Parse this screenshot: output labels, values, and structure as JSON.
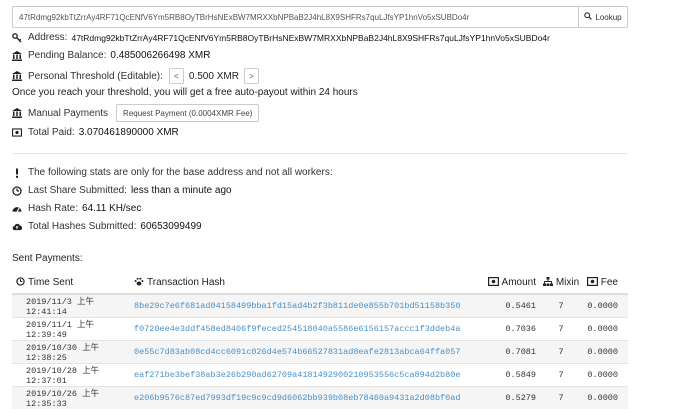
{
  "lookup": {
    "address_value": "47tRdmg92kbTtZrrAy4RF71QcENfV6Ym5RB8OyTBrHsNExBW7MRXXbNPBaB2J4hL8X9SHFRs7quLJfsYP1hnVo5xSUBDo4r",
    "button_label": "Lookup"
  },
  "stats": {
    "address_label": "Address:",
    "address_value": "47tRdmg92kbTtZrrAy4RF71QcENfV6Ym5RB8OyTBrHsNExBW7MRXXbNPBaB2J4hL8X9SHFRs7quLJfsYP1hnVo5xSUBDo4r",
    "pending_label": "Pending Balance:",
    "pending_value": "0.485006266498 XMR",
    "threshold_label": "Personal Threshold (Editable):",
    "threshold_dec": "<",
    "threshold_value": "0.500 XMR",
    "threshold_inc": ">",
    "threshold_note": "Once you reach your threshold, you will get a free auto-payout within 24 hours",
    "manual_label": "Manual Payments",
    "manual_button": "Request Payment (0.0004XMR Fee)",
    "total_paid_label": "Total Paid:",
    "total_paid_value": "3.070461890000 XMR"
  },
  "base_stats": {
    "notice": "The following stats are only for the base address and not all workers:",
    "last_share_label": "Last Share Submitted:",
    "last_share_value": "less than a minute ago",
    "hash_rate_label": "Hash Rate:",
    "hash_rate_value": "64.11 KH/sec",
    "total_hashes_label": "Total Hashes Submitted:",
    "total_hashes_value": "60653099499"
  },
  "payments": {
    "section_title": "Sent Payments:",
    "headers": [
      "Time Sent",
      "Transaction Hash",
      "Amount",
      "Mixin",
      "Fee"
    ],
    "rows": [
      [
        "2019/11/3 上午12:41:14",
        "8be29c7e6f681ad04158499bba1fd15ad4b2f3b811de0e855b701bd51158b350",
        "0.5461",
        "7",
        "0.0000"
      ],
      [
        "2019/11/1 上午12:39:49",
        "f0720ee4e3ddf458ed8406f9feced254518040a5586e6156157accc1f3ddeb4a",
        "0.7036",
        "7",
        "0.0000"
      ],
      [
        "2019/10/30 上午12:38:25",
        "0e55c7d83ab08cd4cc6091c026d4e574b66527831ad8eafe2813abca64ffa057",
        "0.7081",
        "7",
        "0.0000"
      ],
      [
        "2019/10/28 上午12:37:01",
        "eaf271be3bef38ab3e26b290ad62709a4181492900210953556c5ca894d2b80e",
        "0.5849",
        "7",
        "0.0000"
      ],
      [
        "2019/10/26 上午12:35:33",
        "e206b9576c87ed7993df19c9c9cd9d6062bb939b08eb78460a9431a2d08bf0ad",
        "0.5279",
        "7",
        "0.0000"
      ]
    ]
  }
}
